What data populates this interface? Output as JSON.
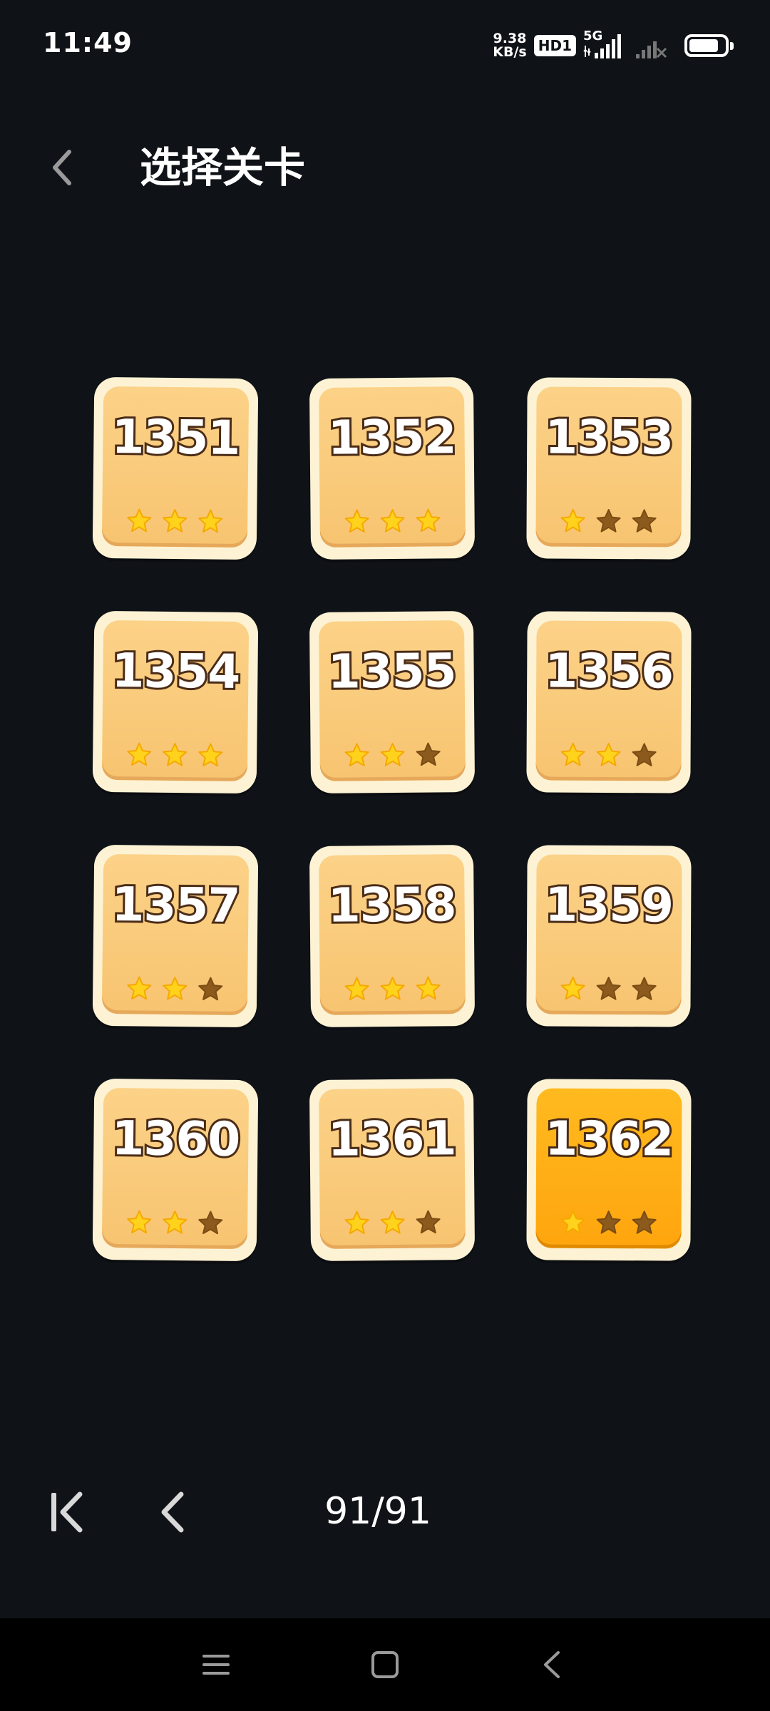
{
  "status_bar": {
    "time": "11:49",
    "net_speed_value": "9.38",
    "net_speed_unit": "KB/s",
    "hd_label": "HD1",
    "network_label": "5G",
    "icons": [
      "signal-icon",
      "signal-no-service-icon",
      "battery-icon"
    ],
    "battery_level": 0.8
  },
  "header": {
    "back_icon": "chevron-left-icon",
    "title": "选择关卡"
  },
  "levels": [
    {
      "number": "1351",
      "stars": 3,
      "current": false
    },
    {
      "number": "1352",
      "stars": 3,
      "current": false
    },
    {
      "number": "1353",
      "stars": 1,
      "current": false
    },
    {
      "number": "1354",
      "stars": 3,
      "current": false
    },
    {
      "number": "1355",
      "stars": 2,
      "current": false
    },
    {
      "number": "1356",
      "stars": 2,
      "current": false
    },
    {
      "number": "1357",
      "stars": 2,
      "current": false
    },
    {
      "number": "1358",
      "stars": 3,
      "current": false
    },
    {
      "number": "1359",
      "stars": 1,
      "current": false
    },
    {
      "number": "1360",
      "stars": 2,
      "current": false
    },
    {
      "number": "1361",
      "stars": 2,
      "current": false
    },
    {
      "number": "1362",
      "stars": 1,
      "current": true
    }
  ],
  "pager": {
    "first_icon": "skip-to-first-icon",
    "prev_icon": "chevron-left-icon",
    "page_text": "91/91"
  },
  "nav_bar": {
    "icons": [
      "menu-icon",
      "home-square-icon",
      "back-chevron-icon"
    ]
  },
  "colors": {
    "background": "#0f1217",
    "card_border": "#fdf3d4",
    "card_fill": "#f7c470",
    "card_current_fill": "#ffa50e",
    "star_earned": "#ffd21c",
    "star_empty": "#8b5a1c",
    "number_outline": "#4a2c17"
  }
}
